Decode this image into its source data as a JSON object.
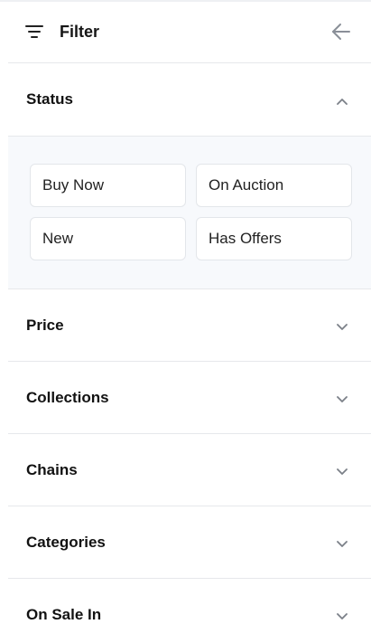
{
  "header": {
    "title": "Filter",
    "filter_icon": "filter-lines-icon",
    "back_icon": "arrow-left-icon"
  },
  "status": {
    "title": "Status",
    "expanded": true,
    "chips": [
      "Buy Now",
      "On Auction",
      "New",
      "Has Offers"
    ]
  },
  "sections": [
    {
      "title": "Price",
      "expanded": false
    },
    {
      "title": "Collections",
      "expanded": false
    },
    {
      "title": "Chains",
      "expanded": false
    },
    {
      "title": "Categories",
      "expanded": false
    },
    {
      "title": "On Sale In",
      "expanded": false
    }
  ],
  "colors": {
    "divider": "#e6e8eb",
    "status_background": "#f7f9fc",
    "chip_border": "#e3e6ea",
    "text": "#121212",
    "icon_muted": "#8a8f98"
  }
}
